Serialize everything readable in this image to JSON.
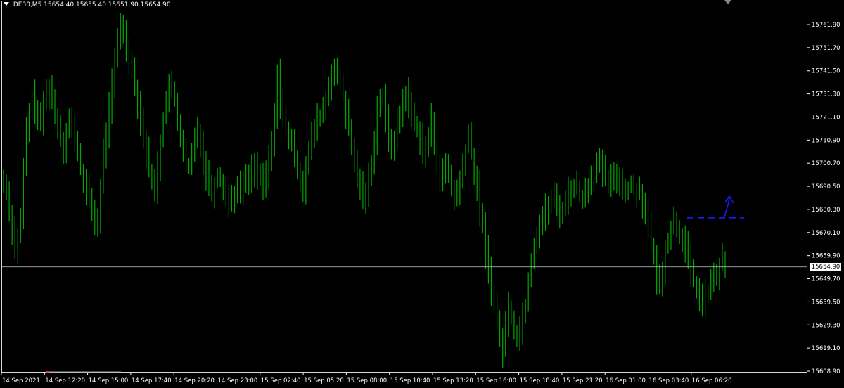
{
  "header": {
    "symbol": "DE30,M5",
    "open": "15654.40",
    "high": "15655.40",
    "low": "15651.90",
    "close": "15654.90"
  },
  "colors": {
    "background": "#000000",
    "bars": "#00a800",
    "bid_line": "#c8c8c8",
    "axis_text": "#ffffff",
    "annotation": "#1a1aff",
    "grid_frame": "#d8d8d8"
  },
  "current_price_label": "15654.90",
  "chart_data": {
    "type": "line",
    "title": "",
    "ylim": [
      15607.0,
      15770.0
    ],
    "y_ticks": [
      "15761.90",
      "15751.70",
      "15741.50",
      "15731.30",
      "15721.10",
      "15710.90",
      "15700.70",
      "15690.50",
      "15680.30",
      "15670.10",
      "15659.90",
      "15649.70",
      "15639.50",
      "15629.30",
      "15619.10",
      "15608.90"
    ],
    "x_tick_labels": [
      "14 Sep 2021",
      "14 Sep 12:20",
      "14 Sep 15:00",
      "14 Sep 17:40",
      "14 Sep 20:20",
      "14 Sep 23:00",
      "15 Sep 02:40",
      "15 Sep 05:20",
      "15 Sep 08:00",
      "15 Sep 10:40",
      "15 Sep 13:20",
      "15 Sep 16:00",
      "15 Sep 18:40",
      "15 Sep 21:20",
      "16 Sep 01:00",
      "16 Sep 03:40",
      "16 Sep 06:20"
    ],
    "series": [
      {
        "values": [
          15693,
          15688,
          15680,
          15672,
          15663,
          15668,
          15675,
          15698,
          15715,
          15722,
          15730,
          15726,
          15720,
          15718,
          15728,
          15732,
          15735,
          15728,
          15722,
          15718,
          15712,
          15708,
          15715,
          15720,
          15716,
          15712,
          15705,
          15698,
          15692,
          15688,
          15685,
          15680,
          15676,
          15673,
          15690,
          15705,
          15715,
          15725,
          15735,
          15745,
          15755,
          15763,
          15758,
          15752,
          15748,
          15742,
          15735,
          15728,
          15720,
          15712,
          15705,
          15698,
          15692,
          15690,
          15700,
          15710,
          15720,
          15730,
          15735,
          15732,
          15728,
          15720,
          15712,
          15705,
          15700,
          15698,
          15704,
          15712,
          15716,
          15710,
          15702,
          15696,
          15692,
          15688,
          15692,
          15696,
          15694,
          15690,
          15686,
          15684,
          15686,
          15688,
          15689,
          15690,
          15692,
          15693,
          15695,
          15698,
          15700,
          15696,
          15693,
          15690,
          15696,
          15702,
          15710,
          15720,
          15742,
          15728,
          15720,
          15716,
          15712,
          15708,
          15704,
          15698,
          15694,
          15690,
          15700,
          15705,
          15712,
          15716,
          15720,
          15722,
          15725,
          15728,
          15735,
          15742,
          15740,
          15738,
          15736,
          15730,
          15722,
          15715,
          15708,
          15700,
          15695,
          15690,
          15688,
          15686,
          15694,
          15702,
          15712,
          15725,
          15730,
          15728,
          15720,
          15712,
          15708,
          15712,
          15718,
          15722,
          15728,
          15732,
          15727,
          15722,
          15719,
          15715,
          15712,
          15708,
          15706,
          15712,
          15720,
          15708,
          15700,
          15696,
          15694,
          15700,
          15695,
          15690,
          15685,
          15688,
          15692,
          15700,
          15707,
          15713,
          15705,
          15695,
          15690,
          15680,
          15672,
          15662,
          15654,
          15645,
          15638,
          15630,
          15624,
          15618,
          15630,
          15638,
          15633,
          15627,
          15623,
          15628,
          15634,
          15638,
          15650,
          15658,
          15665,
          15670,
          15674,
          15677,
          15680,
          15682,
          15684,
          15686,
          15682,
          15679,
          15681,
          15684,
          15688,
          15690,
          15691,
          15689,
          15687,
          15685,
          15688,
          15692,
          15695,
          15698,
          15701,
          15699,
          15697,
          15694,
          15692,
          15693,
          15694,
          15696,
          15693,
          15690,
          15689,
          15690,
          15691,
          15690,
          15689,
          15688,
          15684,
          15680,
          15672,
          15665,
          15658,
          15650,
          15645,
          15655,
          15663,
          15668,
          15672,
          15676,
          15673,
          15670,
          15667,
          15663,
          15658,
          15652,
          15648,
          15645,
          15642,
          15640,
          15642,
          15644,
          15648,
          15650,
          15652,
          15655,
          15658,
          15654
        ]
      }
    ],
    "annotations": [
      {
        "type": "dashed-level",
        "price": 15676.6
      },
      {
        "type": "arrow-up",
        "label": ""
      }
    ]
  }
}
